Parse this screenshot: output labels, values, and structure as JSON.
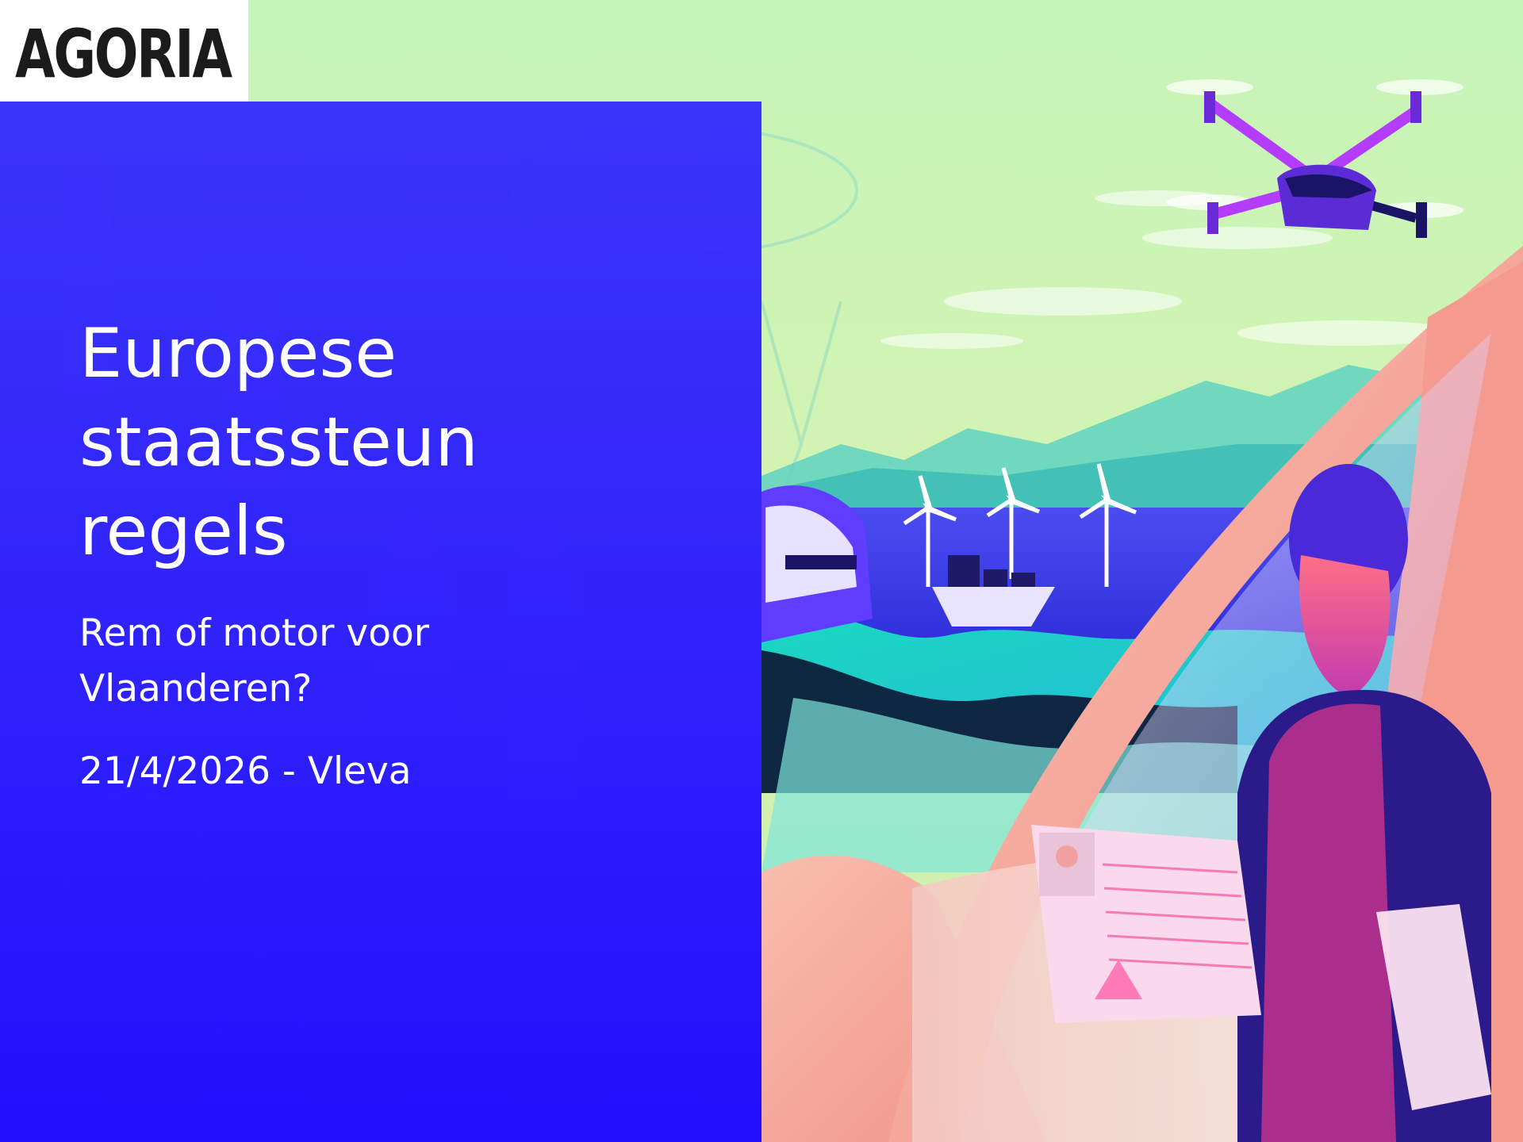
{
  "logo": {
    "text": "AGORIA",
    "accent_color": "#2a1fff"
  },
  "title": {
    "lines": [
      "Europese",
      "staatssteun",
      "regels"
    ]
  },
  "subtitle": {
    "lines": [
      "Rem of motor voor",
      "Vlaanderen?"
    ]
  },
  "date_line": "21/4/2026 - Vleva",
  "colors": {
    "panel_blue": "#2a1fff",
    "sky_green": "#c8f2b6",
    "sea_blue": "#3a3ae0",
    "land_teal": "#1fd6b8",
    "car_pink": "#f7a99a",
    "drone_purple": "#b43cff"
  },
  "illustration": {
    "icons": [
      "drone-icon",
      "wind-turbine-icon",
      "cargo-ship-icon",
      "train-icon",
      "warning-icon",
      "lightning-icon",
      "tablet-icon"
    ]
  }
}
